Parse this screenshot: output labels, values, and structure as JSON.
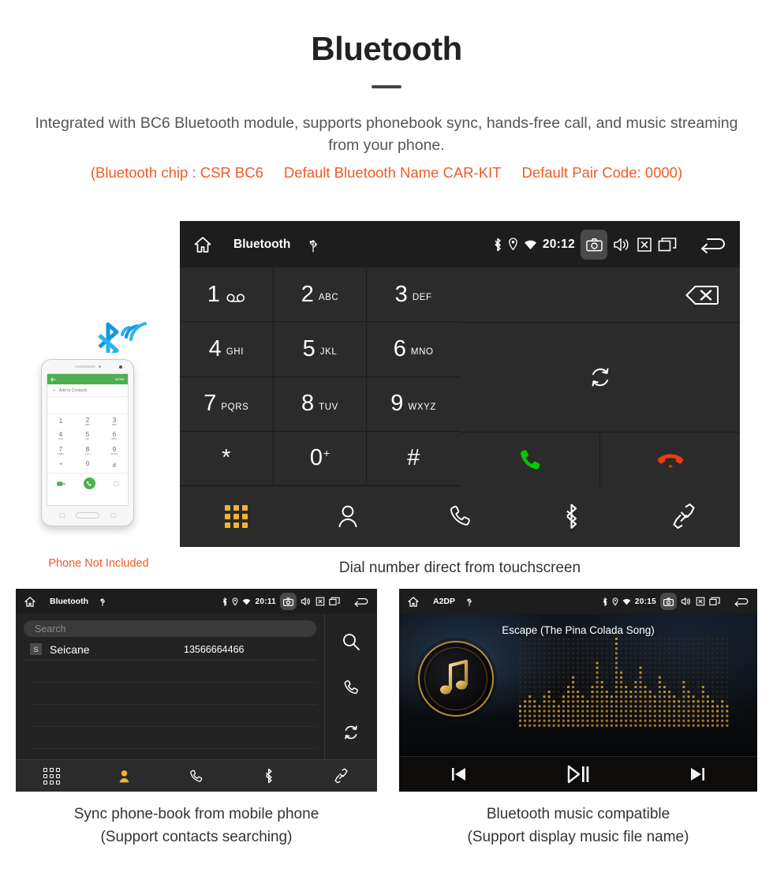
{
  "header": {
    "title": "Bluetooth",
    "intro": "Integrated with BC6 Bluetooth module, supports phonebook sync, hands-free call, and music streaming from your phone.",
    "spec_chip": "(Bluetooth chip : CSR BC6",
    "spec_name": "Default Bluetooth Name CAR-KIT",
    "spec_pair": "Default Pair Code: 0000)",
    "accent_color": "#f05a28",
    "text_color": "#555555"
  },
  "dialer": {
    "statusbar": {
      "home_icon": "home-icon",
      "title": "Bluetooth",
      "usb_icon": "usb-icon",
      "bluetooth_icon": "bluetooth-icon",
      "location_icon": "location-icon",
      "wifi_icon": "wifi-icon",
      "clock": "20:12",
      "camera_icon": "camera-icon",
      "volume_icon": "volume-icon",
      "close_icon": "close-box-icon",
      "recents_icon": "recent-apps-icon",
      "back_icon": "back-icon"
    },
    "keys": [
      {
        "digit": "1",
        "letters": "",
        "voicemail": true
      },
      {
        "digit": "2",
        "letters": "ABC",
        "voicemail": false
      },
      {
        "digit": "3",
        "letters": "DEF",
        "voicemail": false
      },
      {
        "digit": "4",
        "letters": "GHI",
        "voicemail": false
      },
      {
        "digit": "5",
        "letters": "JKL",
        "voicemail": false
      },
      {
        "digit": "6",
        "letters": "MNO",
        "voicemail": false
      },
      {
        "digit": "7",
        "letters": "PQRS",
        "voicemail": false
      },
      {
        "digit": "8",
        "letters": "TUV",
        "voicemail": false
      },
      {
        "digit": "9",
        "letters": "WXYZ",
        "voicemail": false
      },
      {
        "digit": "*",
        "letters": "",
        "voicemail": false
      },
      {
        "digit": "0",
        "letters": "",
        "superscript": "+",
        "voicemail": false
      },
      {
        "digit": "#",
        "letters": "",
        "voicemail": false
      }
    ],
    "side": {
      "backspace_icon": "backspace-icon",
      "sync_icon": "sync-icon",
      "call_icon": "call-icon",
      "call_color": "#05c505",
      "endcall_icon": "end-call-icon",
      "endcall_color": "#ec3b16"
    },
    "nav": [
      {
        "name": "keypad",
        "icon": "keypad-icon",
        "active": true
      },
      {
        "name": "contacts",
        "icon": "person-icon",
        "active": false
      },
      {
        "name": "call-log",
        "icon": "phone-icon",
        "active": false
      },
      {
        "name": "bluetooth",
        "icon": "bluetooth-icon",
        "active": false
      },
      {
        "name": "pair",
        "icon": "link-icon",
        "active": false
      }
    ],
    "active_color": "#f2b134",
    "caption": "Dial number direct from touchscreen"
  },
  "phone_mockup": {
    "bluetooth_signal_icon": "bluetooth-signal-icon",
    "bluetooth_signal_color": "#1fa3e8",
    "green_bar_more": "MORE",
    "green_bar_back_icon": "back-arrow-icon",
    "add_contacts_label": "Add to Contacts",
    "keys": [
      {
        "digit": "1",
        "letters": ""
      },
      {
        "digit": "2",
        "letters": "ABC"
      },
      {
        "digit": "3",
        "letters": "DEF"
      },
      {
        "digit": "4",
        "letters": "GHI"
      },
      {
        "digit": "5",
        "letters": "JKL"
      },
      {
        "digit": "6",
        "letters": "MNO"
      },
      {
        "digit": "7",
        "letters": "PQRS"
      },
      {
        "digit": "8",
        "letters": "TUV"
      },
      {
        "digit": "9",
        "letters": "WXYZ"
      },
      {
        "digit": "*",
        "letters": ""
      },
      {
        "digit": "0",
        "letters": "+"
      },
      {
        "digit": "#",
        "letters": ""
      }
    ],
    "not_included_label": "Phone Not Included"
  },
  "phonebook": {
    "statusbar": {
      "title": "Bluetooth",
      "clock": "20:11"
    },
    "search_placeholder": "Search",
    "contacts": [
      {
        "initial": "S",
        "name": "Seicane",
        "number": "13566664466"
      }
    ],
    "rail": [
      {
        "name": "search",
        "icon": "search-icon"
      },
      {
        "name": "call",
        "icon": "phone-icon"
      },
      {
        "name": "sync",
        "icon": "sync-icon"
      }
    ],
    "nav": [
      {
        "name": "keypad",
        "icon": "keypad-icon",
        "active": false
      },
      {
        "name": "contacts",
        "icon": "person-icon",
        "active": true
      },
      {
        "name": "call-log",
        "icon": "phone-icon",
        "active": false
      },
      {
        "name": "bluetooth",
        "icon": "bluetooth-icon",
        "active": false
      },
      {
        "name": "pair",
        "icon": "link-icon",
        "active": false
      }
    ],
    "caption_line1": "Sync phone-book from mobile phone",
    "caption_line2": "(Support contacts searching)"
  },
  "music": {
    "statusbar": {
      "title": "A2DP",
      "clock": "20:15"
    },
    "song_title": "Escape (The Pina Colada Song)",
    "album_icon": "music-note-bluetooth-icon",
    "accent_color": "#c8952f",
    "controls": [
      {
        "name": "previous",
        "icon": "previous-track-icon"
      },
      {
        "name": "play-pause",
        "icon": "play-pause-icon"
      },
      {
        "name": "next",
        "icon": "next-track-icon"
      }
    ],
    "caption_line1": "Bluetooth music compatible",
    "caption_line2": "(Support display music file name)"
  }
}
